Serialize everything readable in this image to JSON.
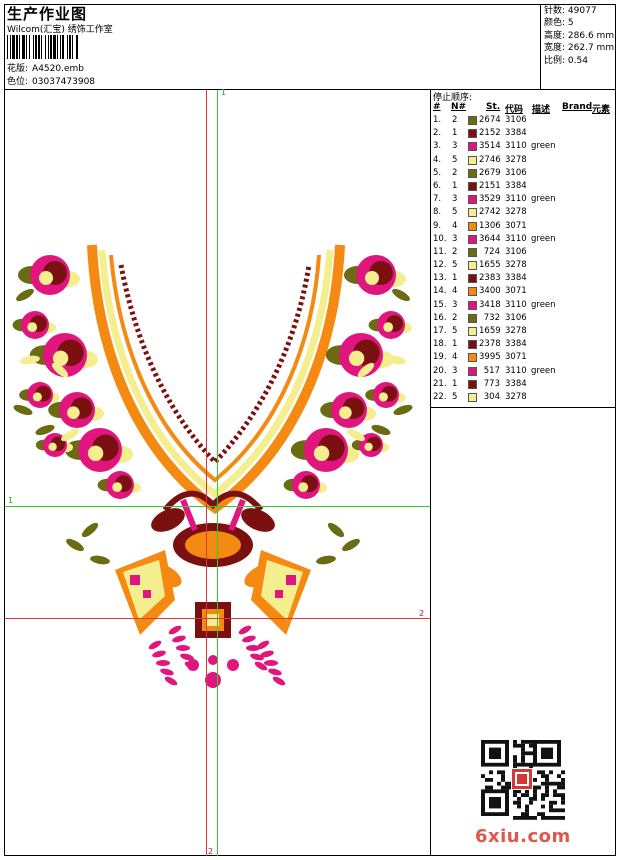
{
  "header": {
    "title": "生产作业图",
    "subtitle": "Wilcom(汇宝) 绣饰工作室",
    "file_label": "花版:",
    "file_value": "A4520.emb",
    "color_seq_label": "色位:",
    "color_seq_value": "03037473908"
  },
  "stats": [
    {
      "label": "针数:",
      "value": "49077"
    },
    {
      "label": "颜色:",
      "value": "5"
    },
    {
      "label": "高度:",
      "value": "286.6 mm"
    },
    {
      "label": "宽度:",
      "value": "262.7 mm"
    },
    {
      "label": "比例:",
      "value": "0.54"
    }
  ],
  "stop_sequence": {
    "title": "停止顺序:",
    "columns": [
      "#",
      "N#",
      "St.",
      "代码",
      "描述",
      "Brand",
      "元素"
    ],
    "rows": [
      {
        "idx": "1.",
        "color": "2",
        "stitches": "2674",
        "code": "3106",
        "desc": "",
        "swatch": "#6b6b12"
      },
      {
        "idx": "2.",
        "color": "1",
        "stitches": "2152",
        "code": "3384",
        "desc": "",
        "swatch": "#7a1010"
      },
      {
        "idx": "3.",
        "color": "3",
        "stitches": "3514",
        "code": "3110",
        "desc": "green",
        "swatch": "#e0157d"
      },
      {
        "idx": "4.",
        "color": "5",
        "stitches": "2746",
        "code": "3278",
        "desc": "",
        "swatch": "#f4ee8e"
      },
      {
        "idx": "5.",
        "color": "2",
        "stitches": "2679",
        "code": "3106",
        "desc": "",
        "swatch": "#6b6b12"
      },
      {
        "idx": "6.",
        "color": "1",
        "stitches": "2151",
        "code": "3384",
        "desc": "",
        "swatch": "#7a1010"
      },
      {
        "idx": "7.",
        "color": "3",
        "stitches": "3529",
        "code": "3110",
        "desc": "green",
        "swatch": "#e0157d"
      },
      {
        "idx": "8.",
        "color": "5",
        "stitches": "2742",
        "code": "3278",
        "desc": "",
        "swatch": "#f4ee8e"
      },
      {
        "idx": "9.",
        "color": "4",
        "stitches": "1306",
        "code": "3071",
        "desc": "",
        "swatch": "#f58a12"
      },
      {
        "idx": "10.",
        "color": "3",
        "stitches": "3644",
        "code": "3110",
        "desc": "green",
        "swatch": "#e0157d"
      },
      {
        "idx": "11.",
        "color": "2",
        "stitches": "724",
        "code": "3106",
        "desc": "",
        "swatch": "#6b6b12"
      },
      {
        "idx": "12.",
        "color": "5",
        "stitches": "1655",
        "code": "3278",
        "desc": "",
        "swatch": "#f4ee8e"
      },
      {
        "idx": "13.",
        "color": "1",
        "stitches": "2383",
        "code": "3384",
        "desc": "",
        "swatch": "#7a1010"
      },
      {
        "idx": "14.",
        "color": "4",
        "stitches": "3400",
        "code": "3071",
        "desc": "",
        "swatch": "#f58a12"
      },
      {
        "idx": "15.",
        "color": "3",
        "stitches": "3418",
        "code": "3110",
        "desc": "green",
        "swatch": "#e0157d"
      },
      {
        "idx": "16.",
        "color": "2",
        "stitches": "732",
        "code": "3106",
        "desc": "",
        "swatch": "#6b6b12"
      },
      {
        "idx": "17.",
        "color": "5",
        "stitches": "1659",
        "code": "3278",
        "desc": "",
        "swatch": "#f4ee8e"
      },
      {
        "idx": "18.",
        "color": "1",
        "stitches": "2378",
        "code": "3384",
        "desc": "",
        "swatch": "#7a1010"
      },
      {
        "idx": "19.",
        "color": "4",
        "stitches": "3995",
        "code": "3071",
        "desc": "",
        "swatch": "#f58a12"
      },
      {
        "idx": "20.",
        "color": "3",
        "stitches": "517",
        "code": "3110",
        "desc": "green",
        "swatch": "#e0157d"
      },
      {
        "idx": "21.",
        "color": "1",
        "stitches": "773",
        "code": "3384",
        "desc": "",
        "swatch": "#7a1010"
      },
      {
        "idx": "22.",
        "color": "5",
        "stitches": "304",
        "code": "3278",
        "desc": "",
        "swatch": "#f4ee8e"
      }
    ]
  },
  "guides": {
    "v_green_label": "1",
    "h_green_label": "1",
    "h_red_label": "2",
    "v_red_label": "2"
  },
  "palette": {
    "olive": "#6b6b12",
    "maroon": "#7a1010",
    "magenta": "#e0157d",
    "cream": "#f4ee8e",
    "orange": "#f58a12"
  },
  "watermark": "6xiu.com"
}
